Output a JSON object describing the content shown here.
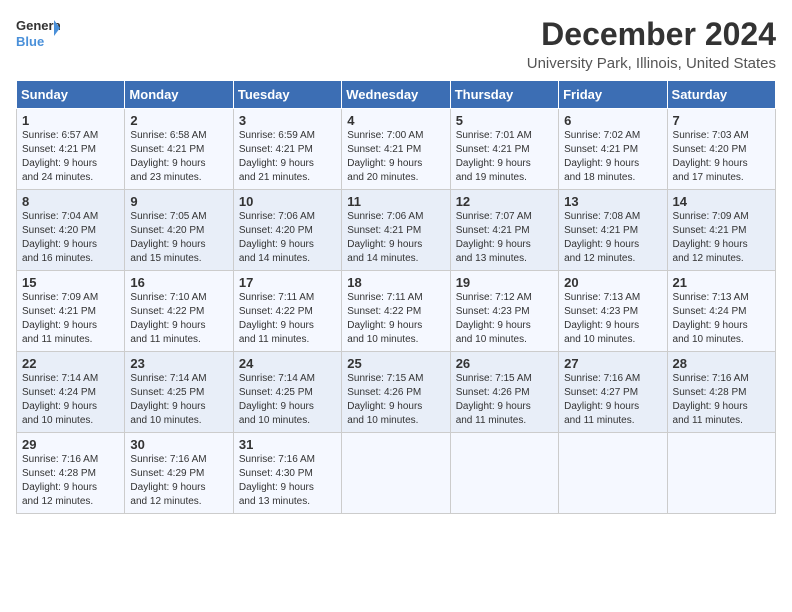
{
  "logo": {
    "line1": "General",
    "line2": "Blue"
  },
  "title": "December 2024",
  "subtitle": "University Park, Illinois, United States",
  "days_header": [
    "Sunday",
    "Monday",
    "Tuesday",
    "Wednesday",
    "Thursday",
    "Friday",
    "Saturday"
  ],
  "weeks": [
    [
      {
        "day": "1",
        "info": "Sunrise: 6:57 AM\nSunset: 4:21 PM\nDaylight: 9 hours\nand 24 minutes."
      },
      {
        "day": "2",
        "info": "Sunrise: 6:58 AM\nSunset: 4:21 PM\nDaylight: 9 hours\nand 23 minutes."
      },
      {
        "day": "3",
        "info": "Sunrise: 6:59 AM\nSunset: 4:21 PM\nDaylight: 9 hours\nand 21 minutes."
      },
      {
        "day": "4",
        "info": "Sunrise: 7:00 AM\nSunset: 4:21 PM\nDaylight: 9 hours\nand 20 minutes."
      },
      {
        "day": "5",
        "info": "Sunrise: 7:01 AM\nSunset: 4:21 PM\nDaylight: 9 hours\nand 19 minutes."
      },
      {
        "day": "6",
        "info": "Sunrise: 7:02 AM\nSunset: 4:21 PM\nDaylight: 9 hours\nand 18 minutes."
      },
      {
        "day": "7",
        "info": "Sunrise: 7:03 AM\nSunset: 4:20 PM\nDaylight: 9 hours\nand 17 minutes."
      }
    ],
    [
      {
        "day": "8",
        "info": "Sunrise: 7:04 AM\nSunset: 4:20 PM\nDaylight: 9 hours\nand 16 minutes."
      },
      {
        "day": "9",
        "info": "Sunrise: 7:05 AM\nSunset: 4:20 PM\nDaylight: 9 hours\nand 15 minutes."
      },
      {
        "day": "10",
        "info": "Sunrise: 7:06 AM\nSunset: 4:20 PM\nDaylight: 9 hours\nand 14 minutes."
      },
      {
        "day": "11",
        "info": "Sunrise: 7:06 AM\nSunset: 4:21 PM\nDaylight: 9 hours\nand 14 minutes."
      },
      {
        "day": "12",
        "info": "Sunrise: 7:07 AM\nSunset: 4:21 PM\nDaylight: 9 hours\nand 13 minutes."
      },
      {
        "day": "13",
        "info": "Sunrise: 7:08 AM\nSunset: 4:21 PM\nDaylight: 9 hours\nand 12 minutes."
      },
      {
        "day": "14",
        "info": "Sunrise: 7:09 AM\nSunset: 4:21 PM\nDaylight: 9 hours\nand 12 minutes."
      }
    ],
    [
      {
        "day": "15",
        "info": "Sunrise: 7:09 AM\nSunset: 4:21 PM\nDaylight: 9 hours\nand 11 minutes."
      },
      {
        "day": "16",
        "info": "Sunrise: 7:10 AM\nSunset: 4:22 PM\nDaylight: 9 hours\nand 11 minutes."
      },
      {
        "day": "17",
        "info": "Sunrise: 7:11 AM\nSunset: 4:22 PM\nDaylight: 9 hours\nand 11 minutes."
      },
      {
        "day": "18",
        "info": "Sunrise: 7:11 AM\nSunset: 4:22 PM\nDaylight: 9 hours\nand 10 minutes."
      },
      {
        "day": "19",
        "info": "Sunrise: 7:12 AM\nSunset: 4:23 PM\nDaylight: 9 hours\nand 10 minutes."
      },
      {
        "day": "20",
        "info": "Sunrise: 7:13 AM\nSunset: 4:23 PM\nDaylight: 9 hours\nand 10 minutes."
      },
      {
        "day": "21",
        "info": "Sunrise: 7:13 AM\nSunset: 4:24 PM\nDaylight: 9 hours\nand 10 minutes."
      }
    ],
    [
      {
        "day": "22",
        "info": "Sunrise: 7:14 AM\nSunset: 4:24 PM\nDaylight: 9 hours\nand 10 minutes."
      },
      {
        "day": "23",
        "info": "Sunrise: 7:14 AM\nSunset: 4:25 PM\nDaylight: 9 hours\nand 10 minutes."
      },
      {
        "day": "24",
        "info": "Sunrise: 7:14 AM\nSunset: 4:25 PM\nDaylight: 9 hours\nand 10 minutes."
      },
      {
        "day": "25",
        "info": "Sunrise: 7:15 AM\nSunset: 4:26 PM\nDaylight: 9 hours\nand 10 minutes."
      },
      {
        "day": "26",
        "info": "Sunrise: 7:15 AM\nSunset: 4:26 PM\nDaylight: 9 hours\nand 11 minutes."
      },
      {
        "day": "27",
        "info": "Sunrise: 7:16 AM\nSunset: 4:27 PM\nDaylight: 9 hours\nand 11 minutes."
      },
      {
        "day": "28",
        "info": "Sunrise: 7:16 AM\nSunset: 4:28 PM\nDaylight: 9 hours\nand 11 minutes."
      }
    ],
    [
      {
        "day": "29",
        "info": "Sunrise: 7:16 AM\nSunset: 4:28 PM\nDaylight: 9 hours\nand 12 minutes."
      },
      {
        "day": "30",
        "info": "Sunrise: 7:16 AM\nSunset: 4:29 PM\nDaylight: 9 hours\nand 12 minutes."
      },
      {
        "day": "31",
        "info": "Sunrise: 7:16 AM\nSunset: 4:30 PM\nDaylight: 9 hours\nand 13 minutes."
      },
      null,
      null,
      null,
      null
    ]
  ]
}
